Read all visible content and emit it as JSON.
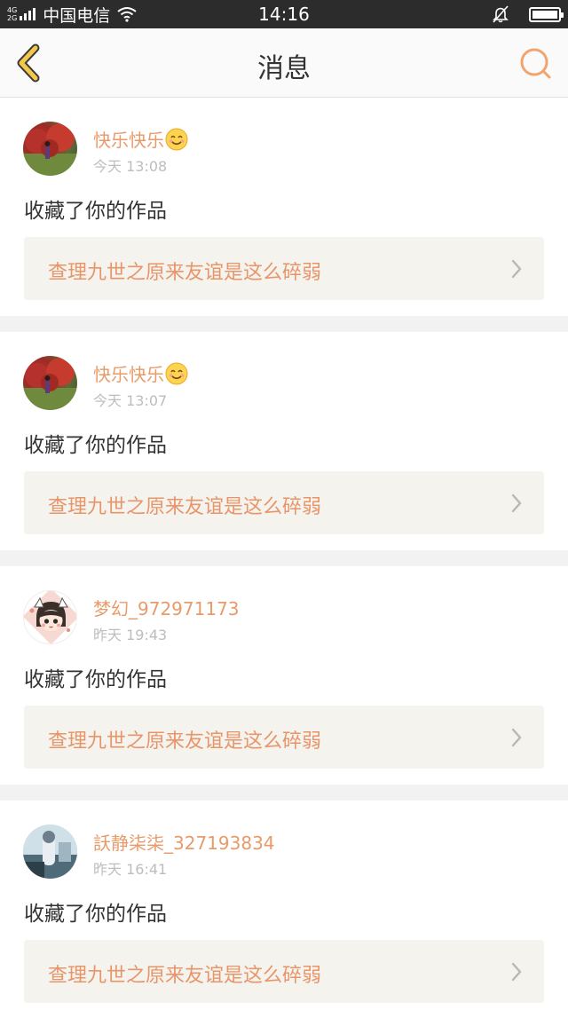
{
  "status_bar": {
    "net_top": "4G",
    "net_bottom": "2G",
    "carrier": "中国电信",
    "time": "14:16"
  },
  "header": {
    "title": "消息"
  },
  "colors": {
    "accent": "#e8956a",
    "back_icon": "#f4c84a"
  },
  "messages": [
    {
      "user": "快乐快乐",
      "emoji": "smiling-face-icon",
      "time": "今天 13:08",
      "action": "收藏了你的作品",
      "work": "查理九世之原来友谊是这么碎弱"
    },
    {
      "user": "快乐快乐",
      "emoji": "smiling-face-icon",
      "time": "今天 13:07",
      "action": "收藏了你的作品",
      "work": "查理九世之原来友谊是这么碎弱"
    },
    {
      "user": "梦幻_972971173",
      "time": "昨天 19:43",
      "action": "收藏了你的作品",
      "work": "查理九世之原来友谊是这么碎弱"
    },
    {
      "user": "訞静柒柒_327193834",
      "time": "昨天 16:41",
      "action": "收藏了你的作品",
      "work": "查理九世之原来友谊是这么碎弱"
    }
  ]
}
